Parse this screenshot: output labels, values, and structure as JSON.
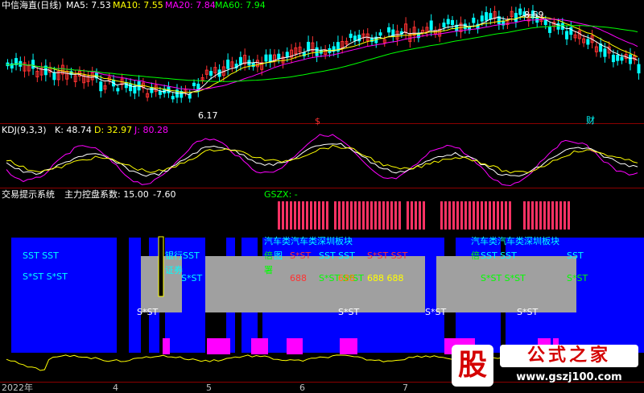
{
  "main_header": {
    "title": "中信海直(日线)",
    "ma5": "MA5: 7.53",
    "ma10": "MA10: 7.55",
    "ma20": "MA20: 7.84",
    "ma60": "MA60: 7.94"
  },
  "price_marks": {
    "high": "8.59",
    "low": "6.17",
    "s_marker": "$",
    "cai_marker": "财"
  },
  "kdj_header": {
    "title": "KDJ(9,3,3)",
    "k": "K: 48.74",
    "d": "D: 32.97",
    "j": "J: 80.28"
  },
  "sys_header": {
    "title": "交易提示系统",
    "control": "主力控盘系数: 15.00",
    "extra": "-7.60",
    "gszx": "GSZX: -"
  },
  "overlay_text": {
    "sst1": "SST  SST",
    "sst2": "S*ST S*ST",
    "bank_sst": "银行SST",
    "securities": "证券",
    "s_st_a": "S*ST",
    "s_st_b": "S*ST",
    "s_st_c": "S*ST",
    "s_st_d": "S*ST",
    "s_st_e": "S*ST",
    "block1": "汽车类汽车类深圳板块",
    "bei1": "倍",
    "wang": "图",
    "shu": "署",
    "sst_mid": "SST SST",
    "s_st_mid": "S*ST",
    "sst_mid2": "S*ST SST",
    "n688a": "688",
    "n688b": "688",
    "n688c": "688 688",
    "s_st_mid2": "S*ST S*ST",
    "block2": "汽车类汽车类深圳板块",
    "bei2": "倍",
    "sst_r": "SST  SST",
    "s_st_r": "S*ST S*ST",
    "sst_rr": "SST",
    "s_st_rr": "S*ST"
  },
  "x_axis": {
    "year": "2022年",
    "m4": "4",
    "m5": "5",
    "m6": "6",
    "m7": "7"
  },
  "watermark": {
    "logo_char": "股",
    "name": "公式之家",
    "url": "www.gszj100.com"
  },
  "colors": {
    "ma5": "#ffffff",
    "ma10": "#ffff00",
    "ma20": "#ff00ff",
    "ma60": "#00ff00",
    "up": "#ff3232",
    "down": "#00ffff",
    "blue_band": "#0000ff",
    "grey_band": "#a0a0a0",
    "magenta": "#ff00ff"
  }
}
